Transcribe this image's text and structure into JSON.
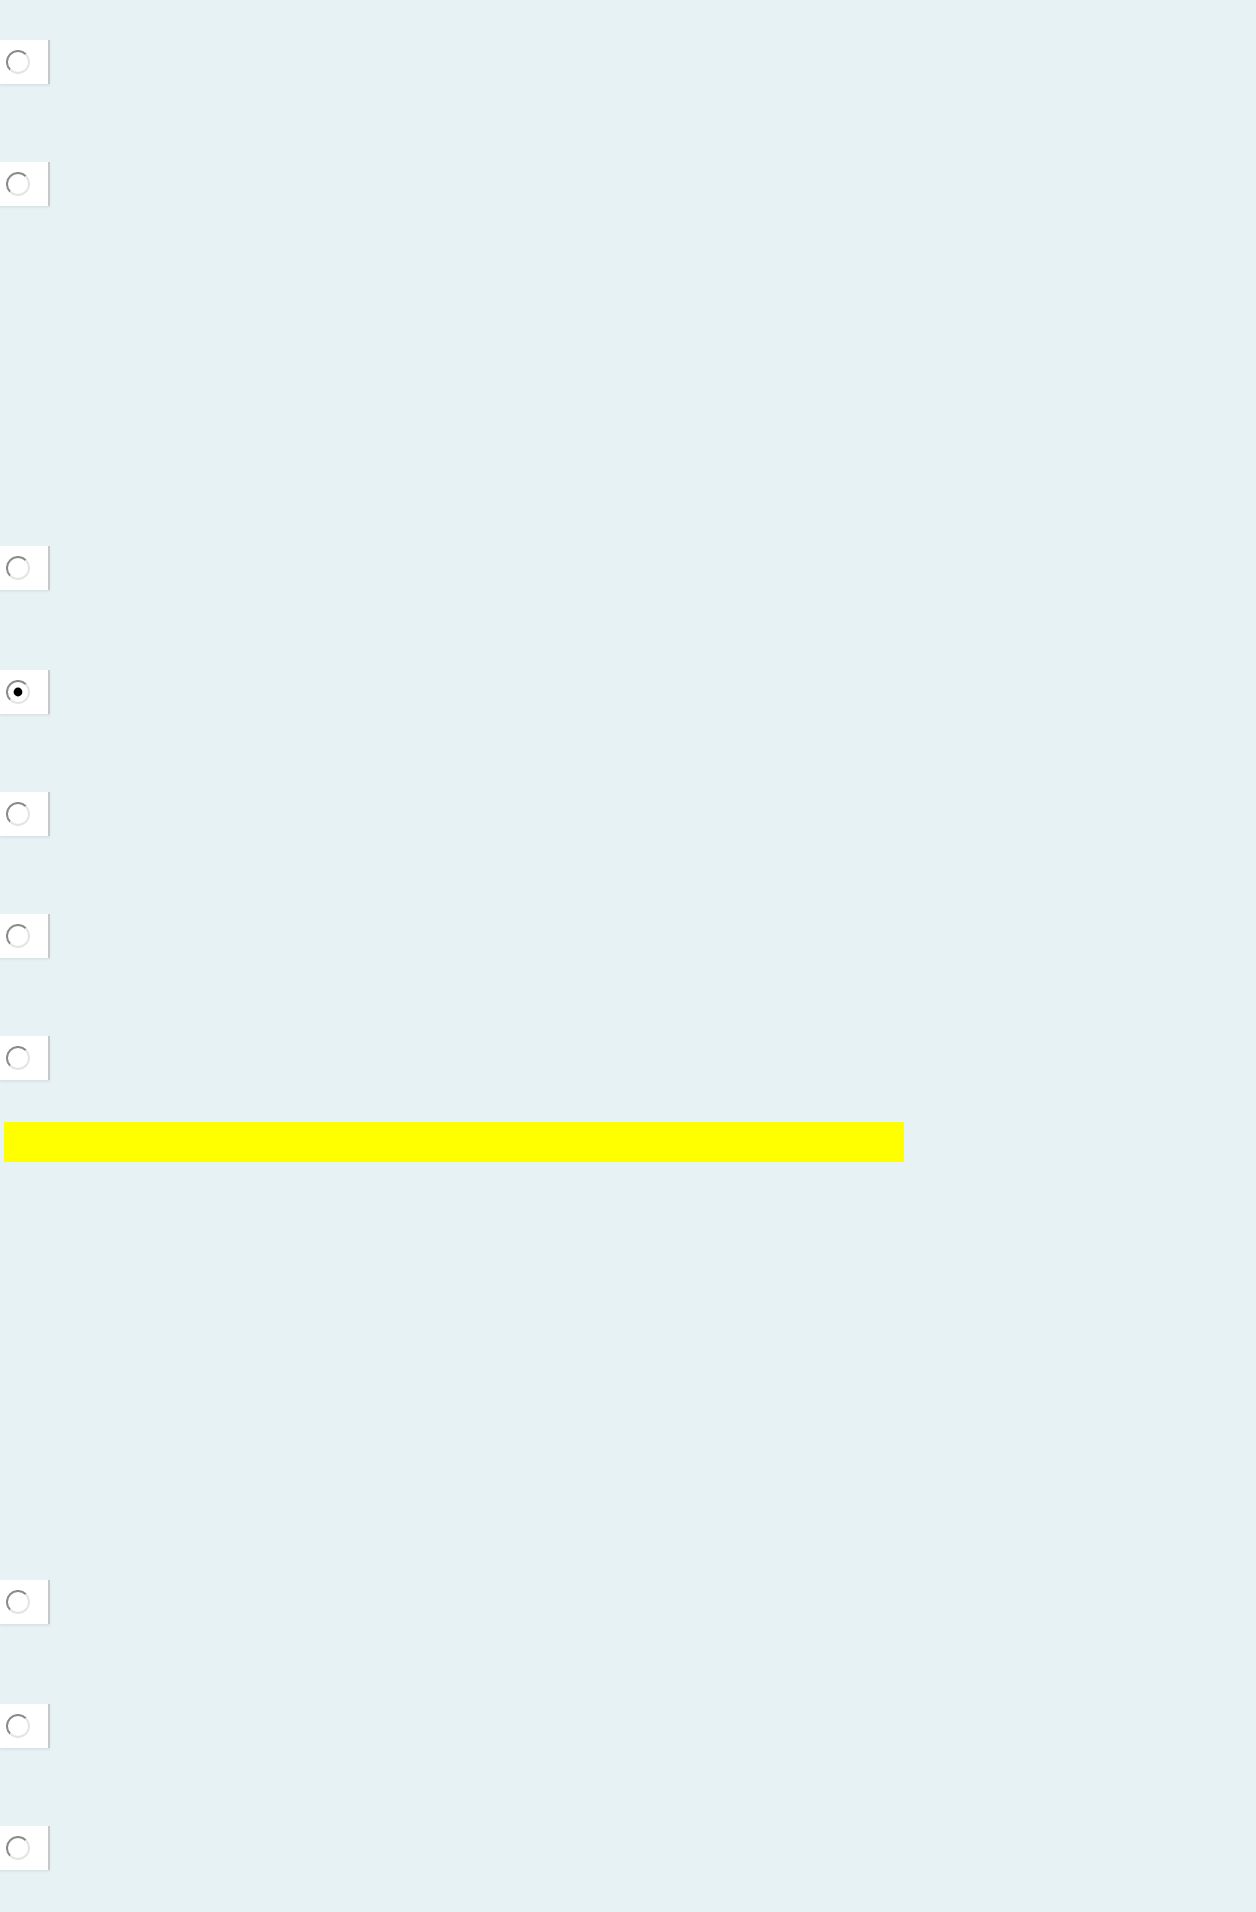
{
  "blocks": [
    {
      "kind": "radio_group",
      "options": [
        {
          "selected": false
        },
        {
          "selected": false
        }
      ]
    },
    {
      "kind": "radio_group",
      "options": [
        {
          "selected": false
        },
        {
          "selected": true
        },
        {
          "selected": false
        },
        {
          "selected": false
        },
        {
          "selected": false
        }
      ]
    },
    {
      "kind": "highlight_bar"
    },
    {
      "kind": "radio_group",
      "options": [
        {
          "selected": false
        },
        {
          "selected": false
        },
        {
          "selected": false
        }
      ]
    }
  ]
}
